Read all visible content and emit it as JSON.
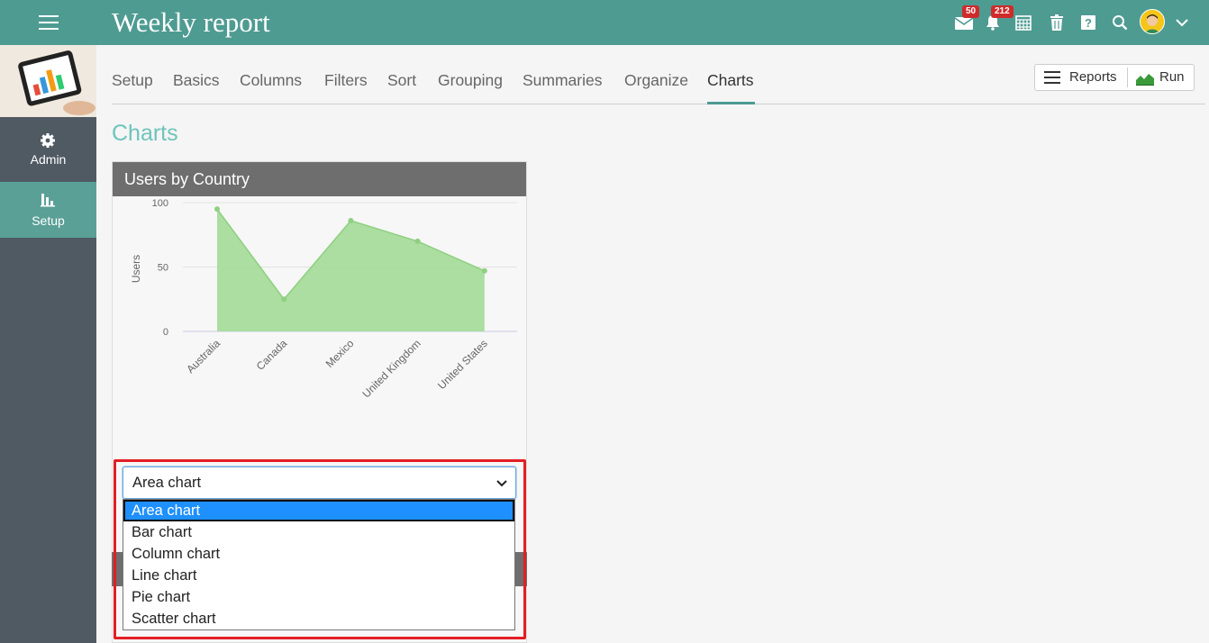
{
  "app": {
    "title": "Weekly report",
    "messages_badge": "50",
    "notifications_badge": "212"
  },
  "sidebar": {
    "items": [
      {
        "label": "Admin",
        "icon": "gear-icon"
      },
      {
        "label": "Setup",
        "icon": "bar-chart-icon"
      }
    ]
  },
  "tabs": [
    "Setup",
    "Basics",
    "Columns",
    "Filters",
    "Sort",
    "Grouping",
    "Summaries",
    "Organize",
    "Charts"
  ],
  "active_tab": "Charts",
  "toolbar": {
    "reports_label": "Reports",
    "run_label": "Run"
  },
  "page": {
    "heading": "Charts"
  },
  "chart_card": {
    "title": "Users by Country"
  },
  "chart_data": {
    "type": "area",
    "title": "Users by Country",
    "xlabel": "",
    "ylabel": "Users",
    "categories": [
      "Australia",
      "Canada",
      "Mexico",
      "United Kingdom",
      "United States"
    ],
    "values": [
      95,
      25,
      86,
      70,
      47
    ],
    "ylim": [
      0,
      100
    ],
    "yticks": [
      "0",
      "50",
      "100"
    ],
    "grid": true,
    "color": "#a6dc9b"
  },
  "chart_type_select": {
    "value": "Area chart",
    "options": [
      "Area chart",
      "Bar chart",
      "Column chart",
      "Line chart",
      "Pie chart",
      "Scatter chart"
    ],
    "highlight_color": "#e31e24"
  },
  "colors": {
    "topbar": "#4e9b92",
    "sidebar": "#505a63",
    "accent": "#6fc4bb",
    "selected_option": "#1e90ff"
  }
}
